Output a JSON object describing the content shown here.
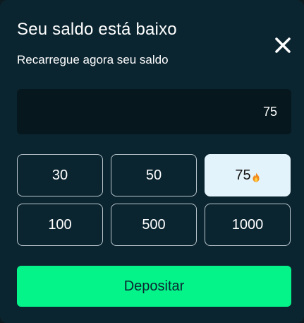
{
  "modal": {
    "title": "Seu saldo está baixo",
    "subtitle": "Recarregue agora seu saldo",
    "close_icon": "close-icon"
  },
  "amount_field": {
    "value": "75"
  },
  "options": [
    {
      "label": "30",
      "selected": false
    },
    {
      "label": "50",
      "selected": false
    },
    {
      "label": "75",
      "selected": true,
      "icon": "fire-icon"
    },
    {
      "label": "100",
      "selected": false
    },
    {
      "label": "500",
      "selected": false
    },
    {
      "label": "1000",
      "selected": false
    }
  ],
  "deposit_button": {
    "label": "Depositar"
  },
  "colors": {
    "background": "#0b2530",
    "input_bg": "#06171d",
    "selected_bg": "#e3f3fb",
    "accent_green": "#05f48a"
  }
}
